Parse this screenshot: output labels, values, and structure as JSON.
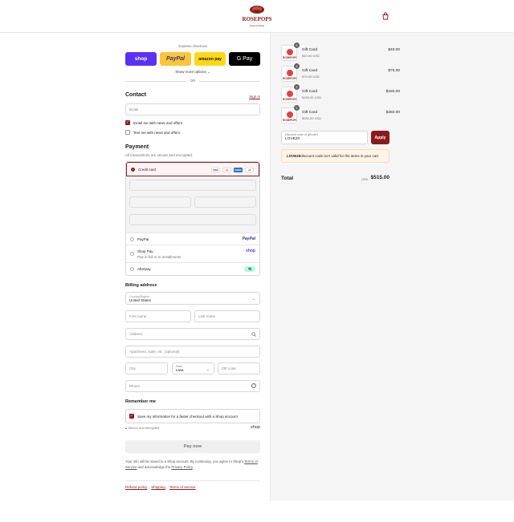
{
  "header": {
    "logo_top": "ROSEPOPS",
    "logo_bottom": "Natural Body"
  },
  "express": {
    "label": "Express checkout",
    "shop": "shop",
    "paypal": "PayPal",
    "amazon": "amazon pay",
    "gpay": "G Pay",
    "more": "Show more options",
    "or": "OR"
  },
  "contact": {
    "title": "Contact",
    "sign_in": "Sign in",
    "email_placeholder": "Email",
    "news_label": "Email me with news and offers",
    "news_checked": true,
    "text_label": "Text me with news and offers",
    "text_checked": false
  },
  "payment": {
    "title": "Payment",
    "subtitle": "All transactions are secure and encrypted.",
    "credit_card": "Credit card",
    "brands": [
      "VISA",
      "MC",
      "AMEX",
      "+5"
    ],
    "paypal": "PayPal",
    "paypal_logo": "PayPal",
    "shop_pay": "Shop Pay",
    "shop_pay_sub": "Pay in full or in installments",
    "shop_logo": "shop",
    "afterpay": "Afterpay"
  },
  "billing": {
    "title": "Billing address",
    "country_label": "Country/Region",
    "country_value": "United States",
    "first_name": "First name",
    "last_name": "Last name",
    "address": "Address",
    "apartment": "Apartment, suite, etc. (optional)",
    "city": "City",
    "state_label": "State",
    "state_value": "Iowa",
    "zip": "ZIP code",
    "phone": "Phone"
  },
  "remember": {
    "title": "Remember me",
    "save_label": "Save my information for a faster checkout with a Shop account",
    "save_checked": true,
    "secure": "Secure and encrypted",
    "shop_logo": "shop"
  },
  "pay_now": "Pay now",
  "terms": {
    "line1": "Your info will be saved to a Shop account. By continuing, you agree to Shop's",
    "tos": "Terms of Service",
    "mid": "and acknowledge the",
    "privacy": "Privacy Policy",
    "end": "."
  },
  "footer": [
    "Refund policy",
    "Shipping",
    "Terms of service"
  ],
  "cart": {
    "items": [
      {
        "name": "Gift Card",
        "variant": "$40.00 USD",
        "price": "$40.00",
        "qty": "1"
      },
      {
        "name": "Gift Card",
        "variant": "$75.00 USD",
        "price": "$75.00",
        "qty": "1"
      },
      {
        "name": "Gift Card",
        "variant": "$150.00 USD",
        "price": "$150.00",
        "qty": "1"
      },
      {
        "name": "Gift Card",
        "variant": "$250.00 USD",
        "price": "$250.00",
        "qty": "1"
      }
    ],
    "discount_label": "Discount code or gift card",
    "discount_value": "LOVE20",
    "apply": "Apply",
    "warning_code": "LOVE20",
    "warning_text": " discount code isn't valid for the items in your cart",
    "total_label": "Total",
    "currency": "USD",
    "total": "$515.00"
  },
  "colors": {
    "accent": "#8b1a1a",
    "shop_purple": "#5a31f4",
    "paypal_yellow": "#ffc439",
    "amazon_yellow": "#ffd814"
  }
}
